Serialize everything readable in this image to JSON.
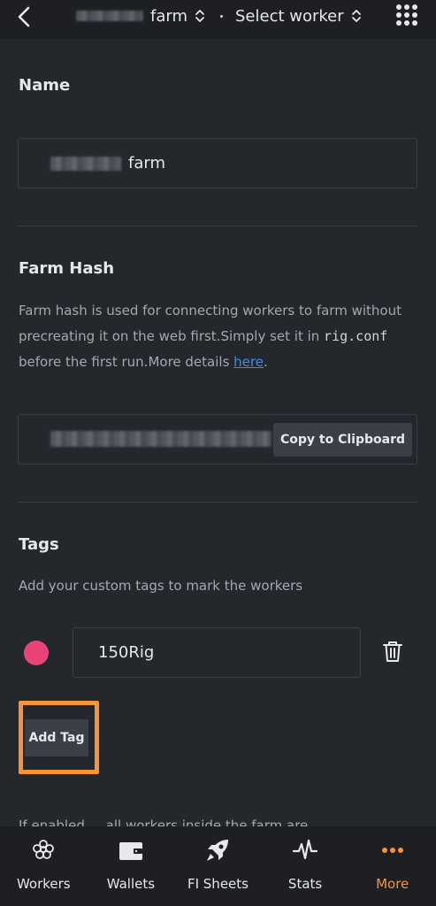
{
  "header": {
    "farm_label": "farm",
    "worker_label": "Select worker"
  },
  "name_section": {
    "title": "Name",
    "value_suffix": "farm"
  },
  "farm_hash_section": {
    "title": "Farm Hash",
    "desc_part1": "Farm hash is used for connecting workers to farm without precreating it on the web first.Simply set it in ",
    "desc_code": "rig.conf",
    "desc_part2": " before the first run.More details ",
    "desc_link": "here",
    "desc_end": ".",
    "copy_button": "Copy to Clipboard"
  },
  "tags_section": {
    "title": "Tags",
    "desc": "Add your custom tags to mark the workers",
    "tags": [
      {
        "name": "150Rig",
        "color": "#e84477"
      }
    ],
    "add_button": "Add Tag"
  },
  "cut_text": "If enabled ... all workers inside the farm are",
  "bottom_nav": {
    "items": [
      {
        "label": "Workers",
        "icon": "workers-icon"
      },
      {
        "label": "Wallets",
        "icon": "wallet-icon"
      },
      {
        "label": "FI Sheets",
        "icon": "rocket-icon"
      },
      {
        "label": "Stats",
        "icon": "pulse-icon"
      },
      {
        "label": "More",
        "icon": "more-icon"
      }
    ],
    "active": "More"
  },
  "colors": {
    "accent": "#f7943a",
    "link": "#3e8de8",
    "tag_pink": "#e84477"
  }
}
